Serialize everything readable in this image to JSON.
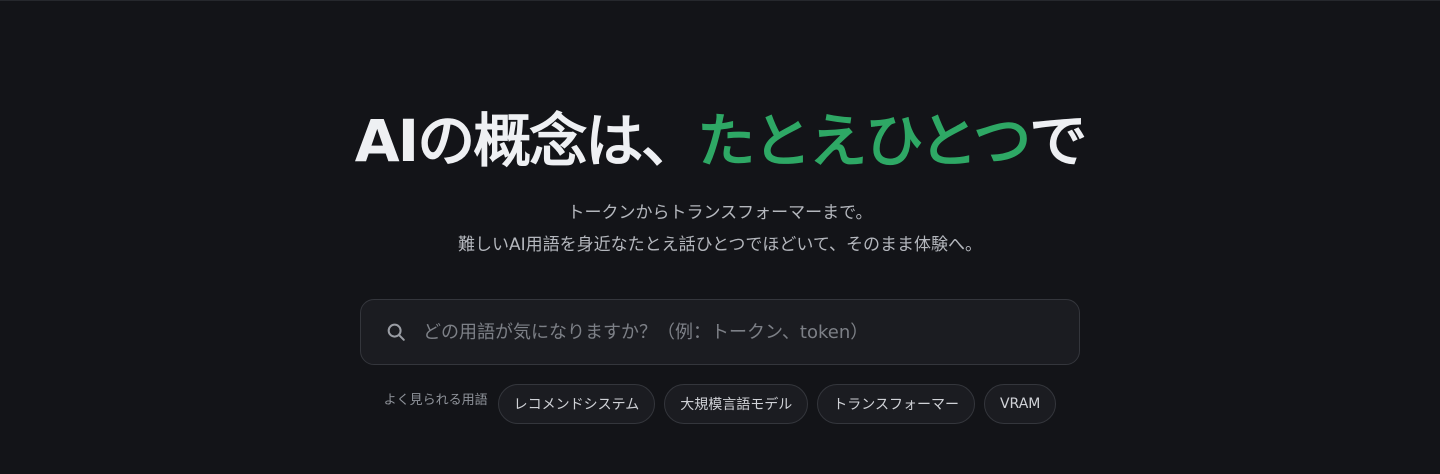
{
  "hero": {
    "title_plain": "AIの概念は、",
    "title_accent": "たとえひとつ",
    "title_suffix": "で",
    "subtitle_line1": "トークンからトランスフォーマーまで。",
    "subtitle_line2": "難しいAI用語を身近なたとえ話ひとつでほどいて、そのまま体験へ。"
  },
  "search": {
    "icon": "search-icon",
    "value": "",
    "placeholder": "どの用語が気になりますか？（例：トークン、token）"
  },
  "popular": {
    "label": "よく見られる用語",
    "chips": [
      "レコメンドシステム",
      "大規模言語モデル",
      "トランスフォーマー",
      "VRAM"
    ]
  },
  "colors": {
    "background": "#131418",
    "accent": "#2ea865",
    "title": "#eef0f3",
    "subtitle": "#b4b7bd",
    "border": "#34363c"
  }
}
